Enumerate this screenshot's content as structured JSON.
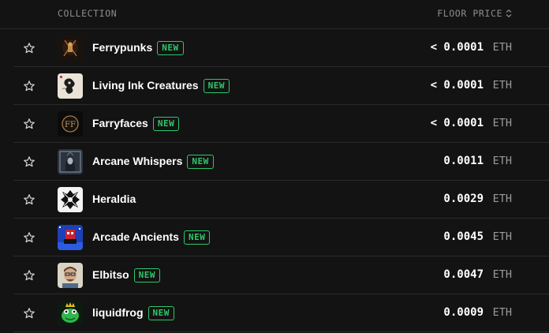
{
  "header": {
    "collection_label": "COLLECTION",
    "floor_price_label": "FLOOR PRICE",
    "sort_icon": "sort-updown-icon"
  },
  "badge_color": "#2ec76a",
  "rows": [
    {
      "name": "Ferrypunks",
      "new": "NEW",
      "price": "< 0.0001",
      "unit": "ETH",
      "icon": "ferrypunks-avatar"
    },
    {
      "name": "Living Ink Creatures",
      "new": "NEW",
      "price": "< 0.0001",
      "unit": "ETH",
      "icon": "living-ink-avatar"
    },
    {
      "name": "Farryfaces",
      "new": "NEW",
      "price": "< 0.0001",
      "unit": "ETH",
      "icon": "farryfaces-avatar"
    },
    {
      "name": "Arcane Whispers",
      "new": "NEW",
      "price": "0.0011",
      "unit": "ETH",
      "icon": "arcane-whispers-avatar"
    },
    {
      "name": "Heraldia",
      "new": "",
      "price": "0.0029",
      "unit": "ETH",
      "icon": "heraldia-avatar"
    },
    {
      "name": "Arcade Ancients",
      "new": "NEW",
      "price": "0.0045",
      "unit": "ETH",
      "icon": "arcade-ancients-avatar"
    },
    {
      "name": "Elbitso",
      "new": "NEW",
      "price": "0.0047",
      "unit": "ETH",
      "icon": "elbitso-avatar"
    },
    {
      "name": "liquidfrog",
      "new": "NEW",
      "price": "0.0009",
      "unit": "ETH",
      "icon": "liquidfrog-avatar"
    }
  ]
}
